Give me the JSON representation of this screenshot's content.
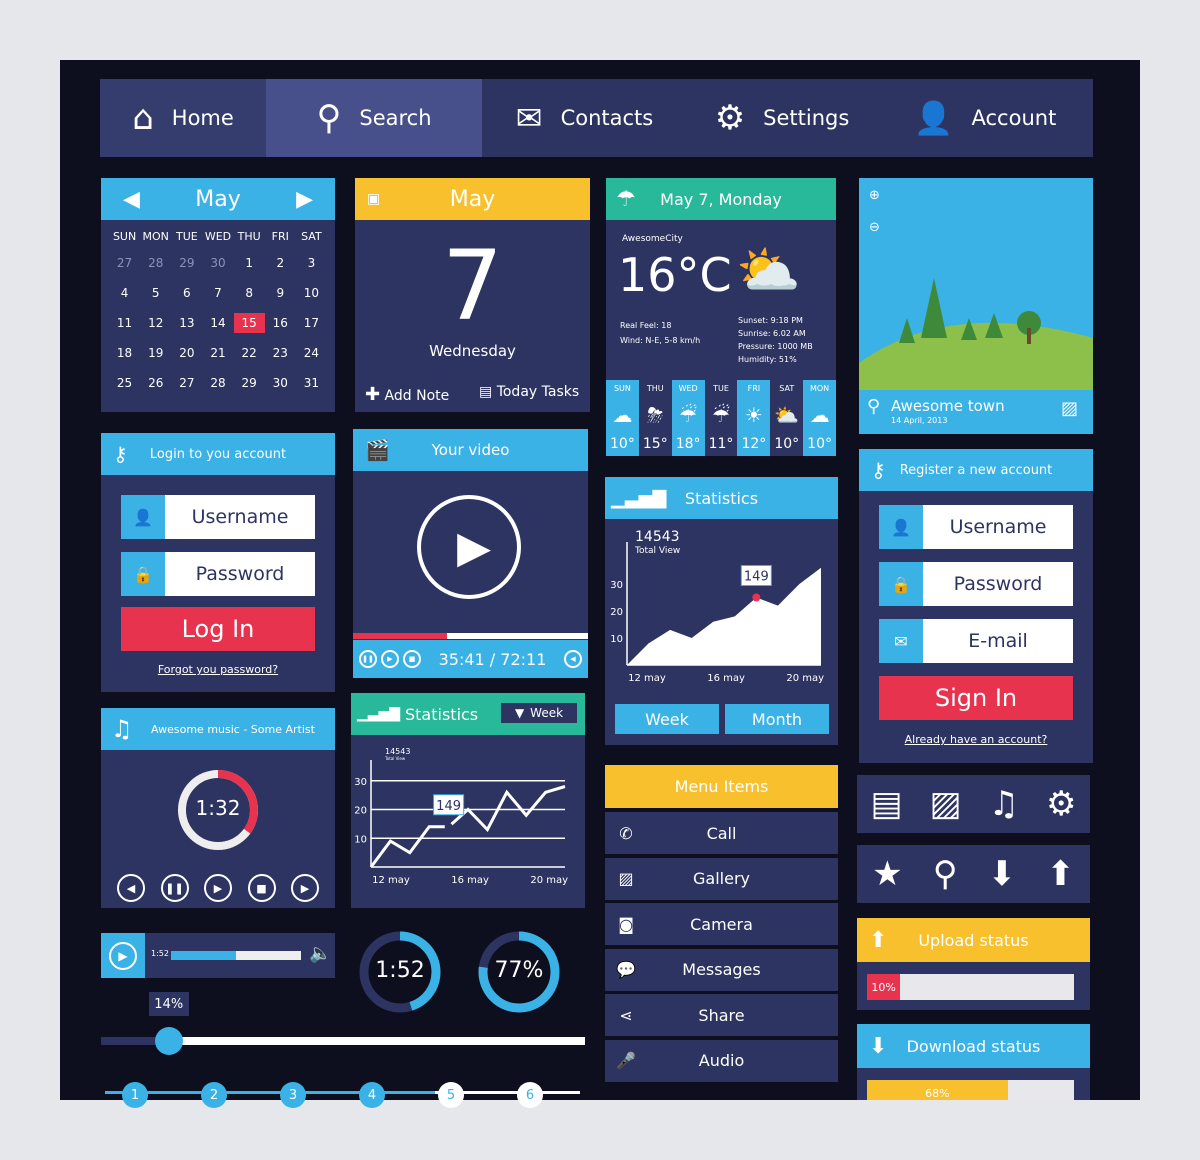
{
  "nav": [
    {
      "label": "Home",
      "icon": "home-icon"
    },
    {
      "label": "Search",
      "icon": "search-icon"
    },
    {
      "label": "Contacts",
      "icon": "envelope-icon"
    },
    {
      "label": "Settings",
      "icon": "gear-icon"
    },
    {
      "label": "Account",
      "icon": "user-icon"
    }
  ],
  "calendar": {
    "month": "May",
    "days": [
      "SUN",
      "MON",
      "TUE",
      "WED",
      "THU",
      "FRI",
      "SAT"
    ],
    "dates": [
      "27",
      "28",
      "29",
      "30",
      "1",
      "2",
      "3",
      "4",
      "5",
      "6",
      "7",
      "8",
      "9",
      "10",
      "11",
      "12",
      "13",
      "14",
      "15",
      "16",
      "17",
      "18",
      "19",
      "20",
      "21",
      "22",
      "23",
      "24",
      "25",
      "26",
      "27",
      "28",
      "29",
      "30",
      "31"
    ],
    "selected": "15"
  },
  "date_card": {
    "month": "May",
    "day": "7",
    "weekday": "Wednesday",
    "add_note": "Add Note",
    "today_tasks": "Today Tasks"
  },
  "weather": {
    "title": "May 7, Monday",
    "city": "AwesomeCity",
    "temp": "16°C",
    "real_feel": "Real Feel: 18",
    "wind": "Wind: N-E, 5-8 km/h",
    "sunset": "Sunset: 9:18 PM",
    "sunrise": "Sunrise: 6.02 AM",
    "pressure": "Pressure: 1000 MB",
    "humidity": "Humidity: 51%",
    "forecast": [
      {
        "day": "SUN",
        "temp": "10°",
        "icon": "cloud-icon"
      },
      {
        "day": "THU",
        "temp": "15°",
        "icon": "storm-icon"
      },
      {
        "day": "WED",
        "temp": "18°",
        "icon": "rain-icon"
      },
      {
        "day": "TUE",
        "temp": "11°",
        "icon": "rain-icon"
      },
      {
        "day": "FRI",
        "temp": "12°",
        "icon": "sun-icon"
      },
      {
        "day": "SAT",
        "temp": "10°",
        "icon": "partly-cloudy-icon"
      },
      {
        "day": "MON",
        "temp": "10°",
        "icon": "cloud-icon"
      }
    ]
  },
  "photo": {
    "place": "Awesome town",
    "date": "14 April, 2013"
  },
  "login": {
    "title": "Login to you account",
    "username": "Username",
    "password": "Password",
    "button": "Log In",
    "forgot": "Forgot you password?"
  },
  "video": {
    "title": "Your video",
    "time": "35:41 / 72:11",
    "progress": 0.4
  },
  "stats_big": {
    "title": "Statistics",
    "total": "14543",
    "total_label": "Total View",
    "callout": "149",
    "tabs": [
      "Week",
      "Month"
    ]
  },
  "register": {
    "title": "Register a new account",
    "username": "Username",
    "password": "Password",
    "email": "E-mail",
    "button": "Sign In",
    "link": "Already have an account?"
  },
  "music": {
    "title": "Awesome music - Some Artist",
    "time": "1:32",
    "progress": 0.35
  },
  "stats_small": {
    "title": "Statistics",
    "dropdown": "Week",
    "total": "14543",
    "total_label": "Total View",
    "callout": "149"
  },
  "menu": {
    "title": "Menu Items",
    "items": [
      {
        "label": "Call",
        "icon": "phone-icon"
      },
      {
        "label": "Gallery",
        "icon": "gallery-icon"
      },
      {
        "label": "Camera",
        "icon": "camera-icon"
      },
      {
        "label": "Messages",
        "icon": "chat-icon"
      },
      {
        "label": "Share",
        "icon": "share-icon"
      },
      {
        "label": "Audio",
        "icon": "microphone-icon"
      }
    ]
  },
  "upload": {
    "title": "Upload status",
    "percent": "10%",
    "value": 0.1
  },
  "download": {
    "title": "Download status",
    "percent": "68%",
    "value": 0.68
  },
  "mini_player": {
    "time": "1:52",
    "progress": 0.5
  },
  "rings": [
    {
      "label": "1:52",
      "value": 0.45
    },
    {
      "label": "77%",
      "value": 0.77
    }
  ],
  "slider": {
    "label": "14%",
    "value": 0.14
  },
  "steps": [
    "1",
    "2",
    "3",
    "4",
    "5",
    "6"
  ],
  "chart_data": [
    {
      "type": "line",
      "name": "stats_big",
      "categories_labels": [
        "12 may",
        "16 may",
        "20 may"
      ],
      "yticks": [
        "10",
        "20",
        "30"
      ],
      "ylim": [
        0,
        40
      ],
      "values": [
        0,
        8,
        13,
        10,
        16,
        18,
        25,
        22,
        30,
        36
      ]
    },
    {
      "type": "line",
      "name": "stats_small",
      "categories_labels": [
        "12 may",
        "16 may",
        "20 may"
      ],
      "yticks": [
        "10",
        "20",
        "30"
      ],
      "ylim": [
        0,
        32
      ],
      "values": [
        0,
        9,
        5,
        14,
        14,
        20,
        13,
        26,
        18,
        26,
        28
      ]
    }
  ],
  "colors": {
    "navy": "#2d3461",
    "blue": "#3bb2e6",
    "teal": "#27b99a",
    "yellow": "#f7c02c",
    "red": "#e8334f",
    "bg": "#0e0f1e"
  }
}
